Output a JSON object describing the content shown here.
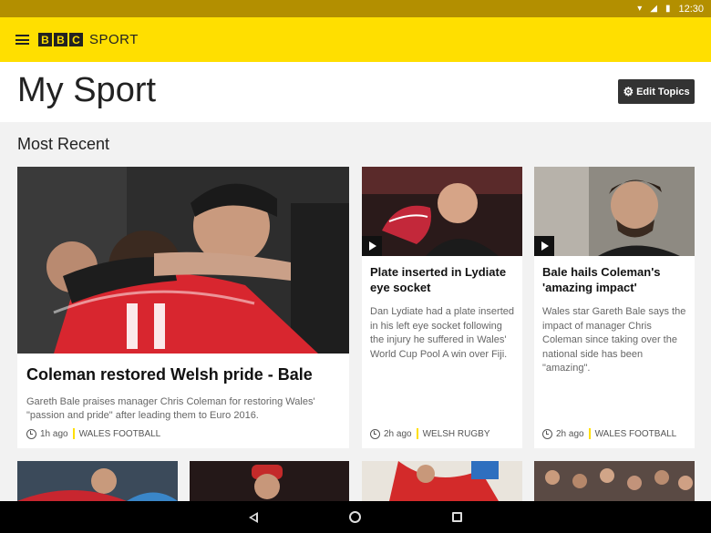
{
  "status_bar": {
    "time": "12:30",
    "icons": [
      "wifi-icon",
      "signal-icon",
      "battery-icon"
    ]
  },
  "app_bar": {
    "logo_letters": [
      "B",
      "B",
      "C"
    ],
    "logo_suffix": "SPORT"
  },
  "page": {
    "title": "My Sport",
    "edit_button_label": "Edit Topics"
  },
  "section": {
    "title": "Most Recent"
  },
  "articles": [
    {
      "headline": "Coleman restored Welsh pride - Bale",
      "summary": "Gareth Bale praises manager Chris Coleman for restoring Wales' \"passion and pride\" after leading them to Euro 2016.",
      "time": "1h ago",
      "topic": "WALES FOOTBALL",
      "has_video": false
    },
    {
      "headline": "Plate inserted in Lydiate eye socket",
      "summary": "Dan Lydiate had a plate inserted in his left eye socket following the injury he suffered in Wales' World Cup Pool A win over Fiji.",
      "time": "2h ago",
      "topic": "WELSH RUGBY",
      "has_video": true
    },
    {
      "headline": "Bale hails Coleman's 'amazing impact'",
      "summary": "Wales star Gareth Bale says the impact of manager Chris Coleman since taking over the national side has been \"amazing\".",
      "time": "2h ago",
      "topic": "WALES FOOTBALL",
      "has_video": true
    }
  ],
  "colors": {
    "brand_yellow": "#ffdf00",
    "status_bar": "#b38f00",
    "topic_separator": "#ffdf00"
  }
}
